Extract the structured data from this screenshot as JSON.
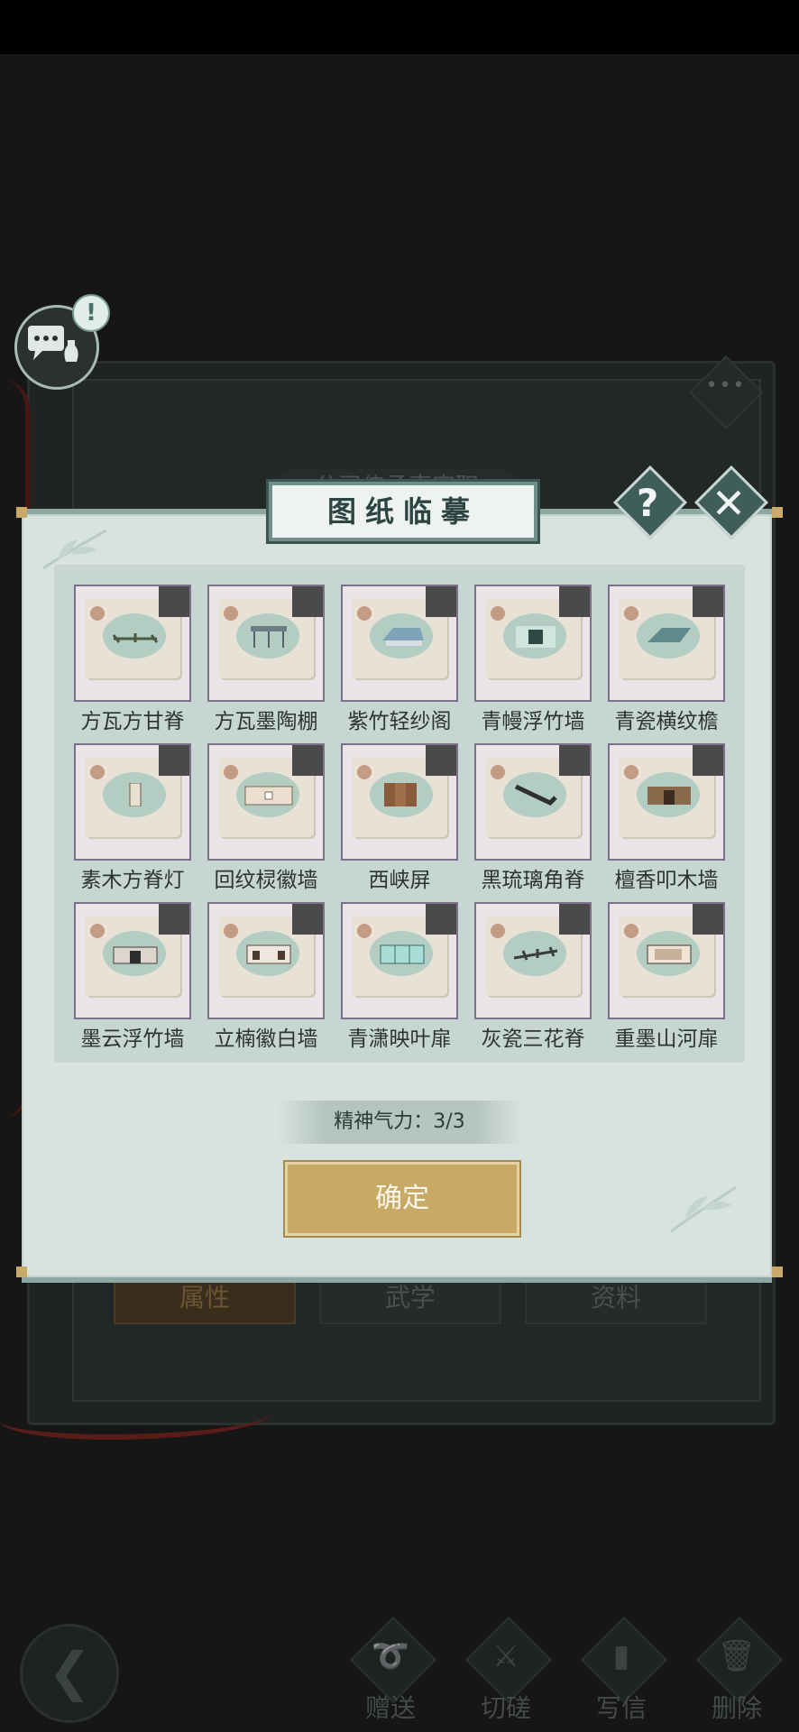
{
  "background": {
    "title": "公司传承事官职",
    "tabs": [
      {
        "label": "属性",
        "active": true
      },
      {
        "label": "武学",
        "active": false
      },
      {
        "label": "资料",
        "active": false
      }
    ],
    "more_label": "•••"
  },
  "dialog": {
    "title": "图纸临摹",
    "help_symbol": "?",
    "close_symbol": "✕",
    "stamina_text": "精神气力：3/3",
    "confirm_label": "确定",
    "items": [
      {
        "name": "方瓦方甘脊",
        "icon": "ridge-beam"
      },
      {
        "name": "方瓦墨陶棚",
        "icon": "pavilion-frame"
      },
      {
        "name": "紫竹轻纱阁",
        "icon": "roof-building"
      },
      {
        "name": "青幔浮竹墙",
        "icon": "wall-window"
      },
      {
        "name": "青瓷横纹檐",
        "icon": "eave"
      },
      {
        "name": "素木方脊灯",
        "icon": "lantern"
      },
      {
        "name": "回纹棂徽墙",
        "icon": "panel-wall"
      },
      {
        "name": "西峡屏",
        "icon": "folding-screen"
      },
      {
        "name": "黑琉璃角脊",
        "icon": "corner-ridge"
      },
      {
        "name": "檀香叩木墙",
        "icon": "wood-wall"
      },
      {
        "name": "墨云浮竹墙",
        "icon": "gate-wall"
      },
      {
        "name": "立楠徽白墙",
        "icon": "white-wall"
      },
      {
        "name": "青潇映叶扉",
        "icon": "glass-room"
      },
      {
        "name": "灰瓷三花脊",
        "icon": "three-ridge"
      },
      {
        "name": "重墨山河扉",
        "icon": "house-room"
      }
    ]
  },
  "bottom": {
    "actions": [
      {
        "label": "赠送",
        "icon": "scroll-icon"
      },
      {
        "label": "切磋",
        "icon": "sword-icon"
      },
      {
        "label": "写信",
        "icon": "letter-icon"
      },
      {
        "label": "删除",
        "icon": "trash-icon"
      }
    ]
  },
  "chat": {
    "alert": "!"
  },
  "colors": {
    "dialog_bg": "#d8e3e0",
    "frame": "#3f5d59",
    "confirm": "#c9a966",
    "thumb_border": "#7e6f8c"
  }
}
